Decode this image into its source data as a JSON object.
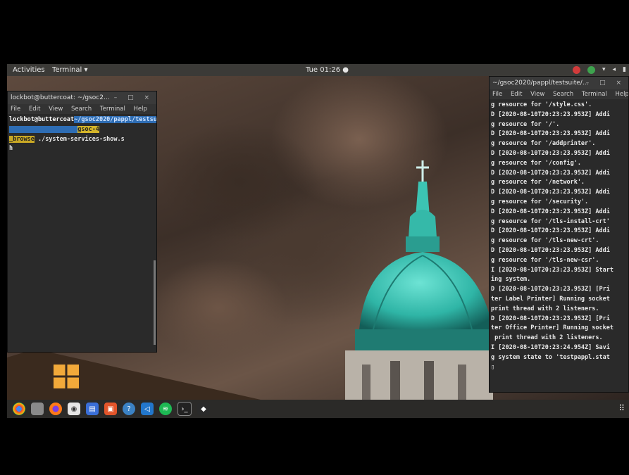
{
  "topbar": {
    "activities": "Activities",
    "app_menu": "Terminal ▾",
    "clock": "Tue 01:26 ●"
  },
  "left_terminal": {
    "title": "lockbot@buttercoat: ~/gsoc2...",
    "window_controls": "– □ ×",
    "menu": [
      "File",
      "Edit",
      "View",
      "Search",
      "Terminal",
      "Help"
    ],
    "prompt_user": "lockbot@buttercoat",
    "prompt_path": "~/gsoc2020/pappl/testsuite",
    "prompt_git": "gsoc-4",
    "prompt_branch": "_browse",
    "command": "./system-services-show.s",
    "cursor_line": "h"
  },
  "right_terminal": {
    "title": "~/gsoc2020/pappl/testsuite/...",
    "window_controls": "– □ ×",
    "menu": [
      "File",
      "Edit",
      "View",
      "Search",
      "Terminal",
      "Help"
    ],
    "lines": [
      "g resource for '/style.css'.",
      "D [2020-08-10T20:23:23.953Z] Addi",
      "g resource for '/'.",
      "D [2020-08-10T20:23:23.953Z] Addi",
      "g resource for '/addprinter'.",
      "D [2020-08-10T20:23:23.953Z] Addi",
      "g resource for '/config'.",
      "D [2020-08-10T20:23:23.953Z] Addi",
      "g resource for '/network'.",
      "D [2020-08-10T20:23:23.953Z] Addi",
      "g resource for '/security'.",
      "D [2020-08-10T20:23:23.953Z] Addi",
      "g resource for '/tls-install-crt'",
      "D [2020-08-10T20:23:23.953Z] Addi",
      "g resource for '/tls-new-crt'.",
      "D [2020-08-10T20:23:23.953Z] Addi",
      "g resource for '/tls-new-csr'.",
      "I [2020-08-10T20:23:23.953Z] Start",
      "ing system.",
      "D [2020-08-10T20:23:23.953Z] [Pri",
      "ter Label Printer] Running socket",
      "print thread with 2 listeners.",
      "D [2020-08-10T20:23:23.953Z] [Pri",
      "ter Office Printer] Running socket",
      " print thread with 2 listeners.",
      "I [2020-08-10T20:23:24.954Z] Savi",
      "g system state to 'testpappl.stat",
      "",
      "▯"
    ]
  },
  "dock": {
    "icons": [
      "chrome-icon",
      "files-icon",
      "firefox-icon",
      "camera-icon",
      "document-icon",
      "shop-icon",
      "help-icon",
      "vscode-icon",
      "spotify-icon",
      "terminal-icon",
      "inkscape-icon"
    ],
    "apps_label": "⠿"
  },
  "colors": {
    "dome": "#2fb5a6",
    "topbar": "#3b3a37",
    "path_segment": "#2e6db4",
    "git_segment": "#d4b52a"
  }
}
